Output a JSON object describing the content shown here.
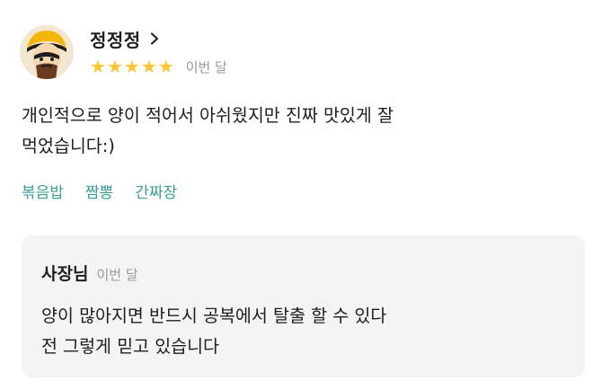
{
  "review": {
    "author": {
      "name": "정정정",
      "avatar_icon": "cartoon-face-avatar"
    },
    "rating": {
      "stars": 5,
      "max": 5,
      "star_color": "#ffc42e"
    },
    "date": "이번 달",
    "body_lines": [
      "개인적으로 양이 적어서 아쉬웠지만 진짜 맛있게 잘",
      "먹었습니다:)"
    ],
    "tags": [
      "볶음밥",
      "짬뽕",
      "간짜장"
    ],
    "tag_color": "#3a9f95"
  },
  "reply": {
    "author": "사장님",
    "date": "이번 달",
    "lines": [
      "양이 많아지면 반드시 공복에서 탈출 할 수 있다",
      "전 그렇게 믿고 있습니다"
    ]
  }
}
